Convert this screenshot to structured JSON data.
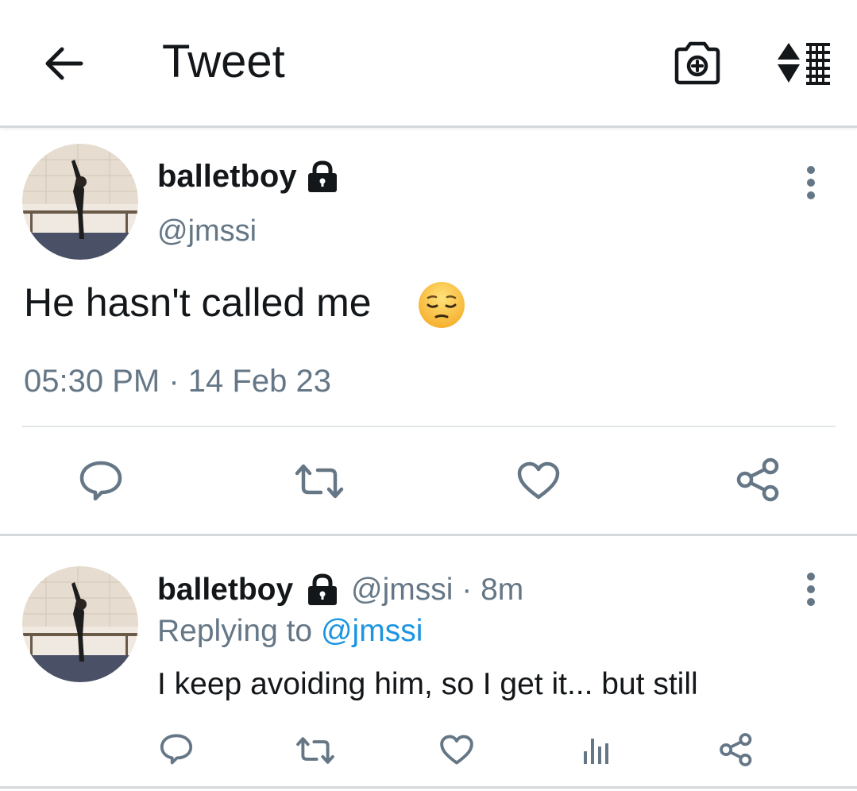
{
  "header": {
    "title": "Tweet",
    "back_icon": "arrow-left-icon",
    "camera_icon": "camera-plus-icon",
    "sort_icon": "sort-list-icon"
  },
  "main_tweet": {
    "display_name": "balletboy",
    "handle": "@jmssi",
    "protected": true,
    "text": "He hasn't called me",
    "emoji": "pensive-face",
    "time": "05:30 PM",
    "separator": "·",
    "date": "14 Feb 23"
  },
  "reply_tweet": {
    "display_name": "balletboy",
    "handle": "@jmssi",
    "separator": "·",
    "age": "8m",
    "replying_prefix": "Replying to",
    "replying_to": "@jmssi",
    "text": "I keep avoiding him, so I get it... but still",
    "protected": true
  },
  "colors": {
    "text_primary": "#14171a",
    "text_secondary": "#657786",
    "link": "#1b95e0",
    "divider": "#e1e5e8"
  }
}
